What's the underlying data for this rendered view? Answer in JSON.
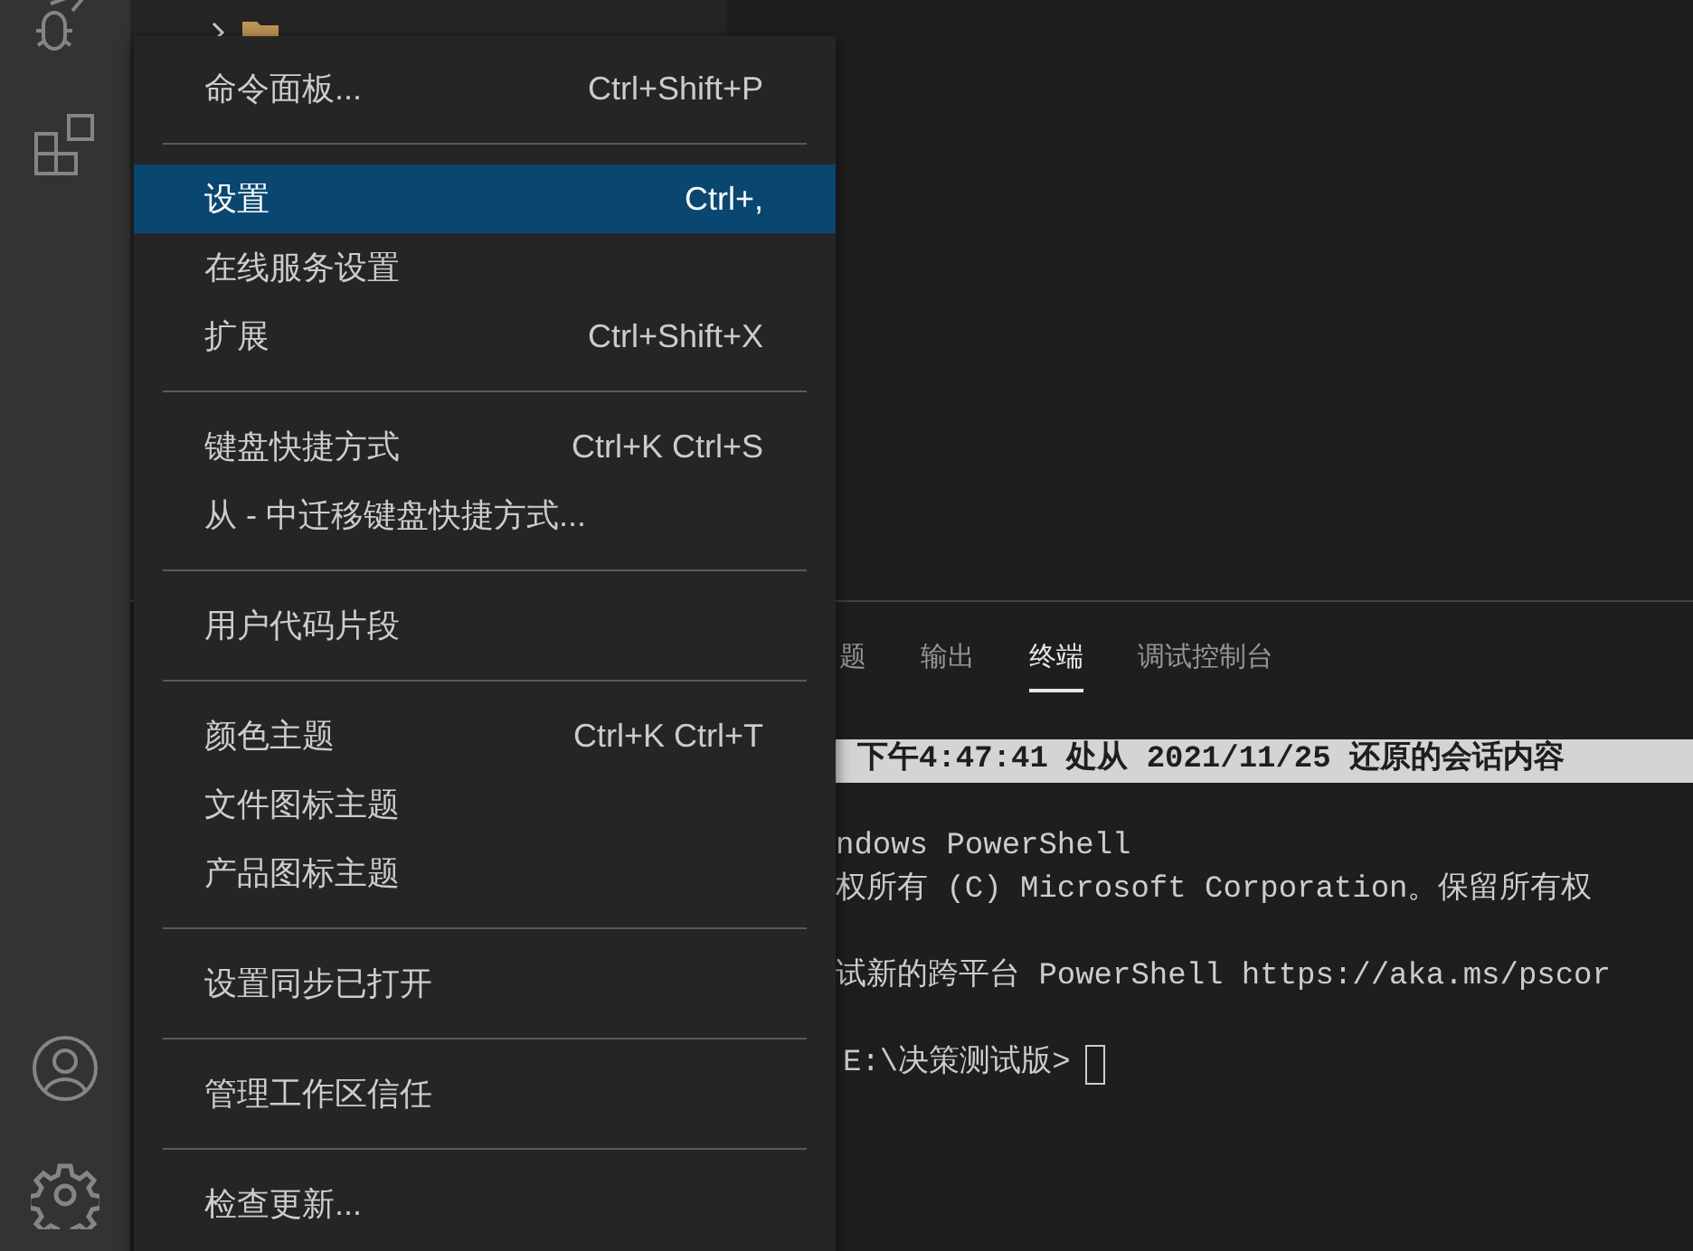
{
  "menu": {
    "items": [
      {
        "kind": "item",
        "label": "命令面板...",
        "shortcut": "Ctrl+Shift+P",
        "selected": false
      },
      {
        "kind": "separator"
      },
      {
        "kind": "item",
        "label": "设置",
        "shortcut": "Ctrl+,",
        "selected": true
      },
      {
        "kind": "item",
        "label": "在线服务设置",
        "selected": false
      },
      {
        "kind": "item",
        "label": "扩展",
        "shortcut": "Ctrl+Shift+X",
        "selected": false
      },
      {
        "kind": "separator"
      },
      {
        "kind": "item",
        "label": "键盘快捷方式",
        "shortcut": "Ctrl+K Ctrl+S",
        "selected": false
      },
      {
        "kind": "item",
        "label": "从 - 中迁移键盘快捷方式...",
        "selected": false
      },
      {
        "kind": "separator"
      },
      {
        "kind": "item",
        "label": "用户代码片段",
        "selected": false
      },
      {
        "kind": "separator"
      },
      {
        "kind": "item",
        "label": "颜色主题",
        "shortcut": "Ctrl+K Ctrl+T",
        "selected": false
      },
      {
        "kind": "item",
        "label": "文件图标主题",
        "selected": false
      },
      {
        "kind": "item",
        "label": "产品图标主题",
        "selected": false
      },
      {
        "kind": "separator"
      },
      {
        "kind": "item",
        "label": "设置同步已打开",
        "selected": false
      },
      {
        "kind": "separator"
      },
      {
        "kind": "item",
        "label": "管理工作区信任",
        "selected": false
      },
      {
        "kind": "separator"
      },
      {
        "kind": "item",
        "label": "检查更新...",
        "selected": false
      }
    ]
  },
  "panel": {
    "tabs": [
      {
        "label": "题",
        "selected": false
      },
      {
        "label": "输出",
        "selected": false
      },
      {
        "label": "终端",
        "selected": true
      },
      {
        "label": "调试控制台",
        "selected": false
      }
    ],
    "terminal": [
      {
        "kind": "banner",
        "text": "下午4:47:41 处从 2021/11/25 还原的会话内容"
      },
      {
        "kind": "blank"
      },
      {
        "kind": "line",
        "text": "ndows PowerShell"
      },
      {
        "kind": "line",
        "text": "权所有 (C) Microsoft Corporation。保留所有权"
      },
      {
        "kind": "blank"
      },
      {
        "kind": "line",
        "text": "试新的跨平台 PowerShell https://aka.ms/pscor"
      },
      {
        "kind": "blank"
      },
      {
        "kind": "prompt",
        "text": "E:\\决策测试版>"
      }
    ]
  }
}
